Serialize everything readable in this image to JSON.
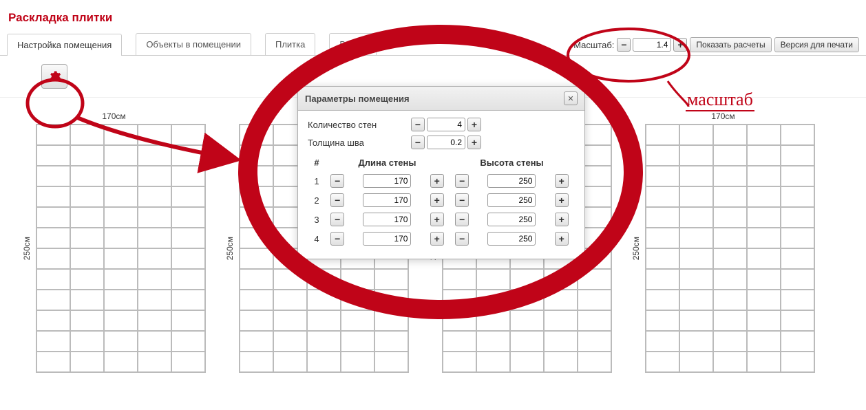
{
  "title": "Раскладка плитки",
  "tabs": [
    "Настройка помещения",
    "Объекты в помещении",
    "Плитка",
    "Выкла"
  ],
  "scale": {
    "label": "Масштаб:",
    "value": "1.4"
  },
  "buttons": {
    "show_calc": "Показать расчеты",
    "print": "Версия для печати"
  },
  "dialog": {
    "title": "Параметры помещения",
    "wall_count_label": "Количество стен",
    "wall_count": "4",
    "seam_label": "Толщина шва",
    "seam": "0.2",
    "col_hash": "#",
    "col_len": "Длина стены",
    "col_h": "Высота стены",
    "rows": [
      {
        "n": "1",
        "len": "170",
        "h": "250"
      },
      {
        "n": "2",
        "len": "170",
        "h": "250"
      },
      {
        "n": "3",
        "len": "170",
        "h": "250"
      },
      {
        "n": "4",
        "len": "170",
        "h": "250"
      }
    ]
  },
  "wall_label_top": "170см",
  "wall_label_side": "250см",
  "annotation_scale": "масштаб"
}
